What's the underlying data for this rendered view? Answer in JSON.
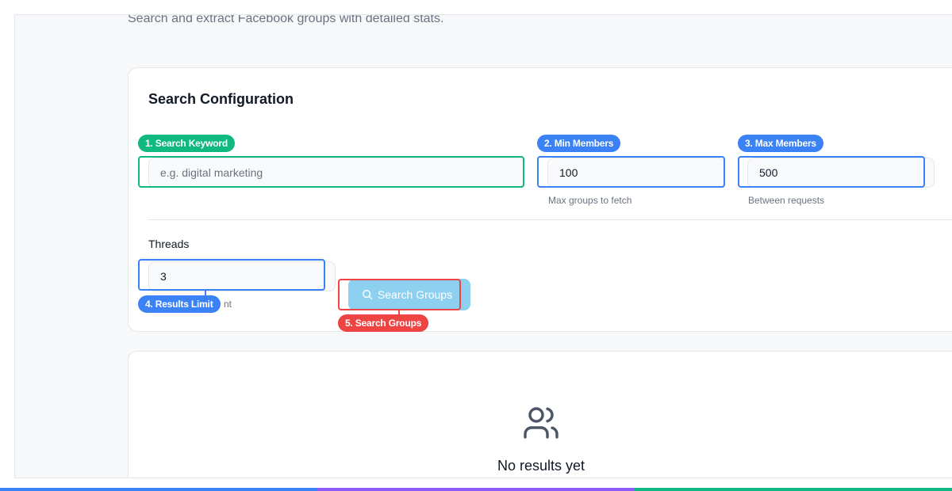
{
  "header": {
    "subtitle": "Search and extract Facebook groups with detailed stats."
  },
  "config": {
    "title": "Search Configuration",
    "keyword": {
      "placeholder": "e.g. digital marketing",
      "value": ""
    },
    "min_members": {
      "value": "100",
      "hint": "Max groups to fetch"
    },
    "max_members": {
      "value": "500",
      "hint": "Between requests"
    },
    "threads": {
      "label": "Threads",
      "value": "3",
      "hint_partial": "nt"
    },
    "search_button": {
      "label": "Search Groups",
      "icon": "search-icon"
    }
  },
  "annotations": [
    {
      "label": "1. Search Keyword",
      "color": "#10b981"
    },
    {
      "label": "2. Min Members",
      "color": "#3b82f6"
    },
    {
      "label": "3. Max Members",
      "color": "#3b82f6"
    },
    {
      "label": "4. Results Limit",
      "color": "#3b82f6"
    },
    {
      "label": "5. Search Groups",
      "color": "#ef4444"
    }
  ],
  "results": {
    "empty_text": "No results yet",
    "empty_icon": "users-icon"
  },
  "bottom_bar_colors": [
    "#3b82f6",
    "#8b5cf6",
    "#10b981"
  ]
}
